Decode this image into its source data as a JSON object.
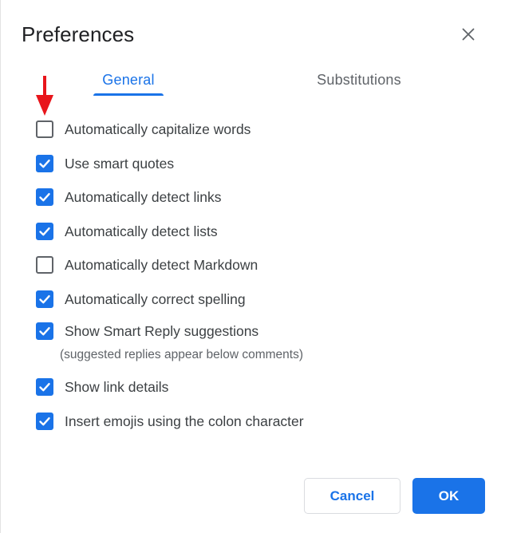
{
  "dialog": {
    "title": "Preferences",
    "close_icon": "close-icon"
  },
  "tabs": [
    {
      "label": "General",
      "active": true
    },
    {
      "label": "Substitutions",
      "active": false
    }
  ],
  "options": [
    {
      "label": "Automatically capitalize words",
      "checked": false
    },
    {
      "label": "Use smart quotes",
      "checked": true
    },
    {
      "label": "Automatically detect links",
      "checked": true
    },
    {
      "label": "Automatically detect lists",
      "checked": true
    },
    {
      "label": "Automatically detect Markdown",
      "checked": false
    },
    {
      "label": "Automatically correct spelling",
      "checked": true
    },
    {
      "label": "Show Smart Reply suggestions",
      "checked": true
    },
    {
      "label": "Show link details",
      "checked": true
    },
    {
      "label": "Insert emojis using the colon character",
      "checked": true
    }
  ],
  "smart_reply_hint": "(suggested replies appear below comments)",
  "annotation": {
    "icon": "red-arrow-down-icon",
    "color": "#e8151b"
  },
  "buttons": {
    "cancel_label": "Cancel",
    "ok_label": "OK"
  },
  "colors": {
    "accent": "#1a73e8",
    "text": "#202124",
    "muted": "#5f6368"
  }
}
